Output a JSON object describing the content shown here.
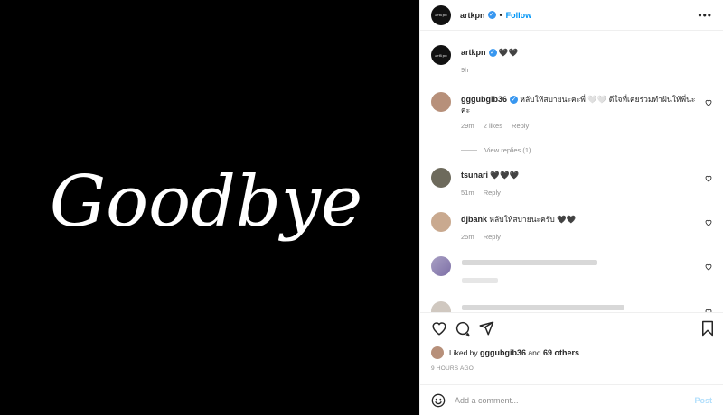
{
  "media": {
    "image_text": "Goodbye",
    "background": "#000000",
    "text_color": "#ffffff"
  },
  "header": {
    "username": "artkpn",
    "separator": "•",
    "follow_label": "Follow",
    "more_icon": "ellipsis-icon"
  },
  "caption": {
    "username": "artkpn",
    "text": "🖤🖤",
    "time": "9h"
  },
  "comments": [
    {
      "username": "gggubgib36",
      "text": "หลับให้สบายนะคะพี่ 🤍🤍 ดีใจที่เคยร่วมทำฝันให้พี่นะคะ",
      "time": "29m",
      "likes": "2 likes",
      "reply": "Reply",
      "view_replies": "View replies (1)"
    },
    {
      "username": "tsunari",
      "text": "🖤🖤🖤",
      "time": "51m",
      "reply": "Reply"
    },
    {
      "username": "djbank",
      "text": "หลับให้สบายนะครับ 🖤🖤",
      "time": "25m",
      "reply": "Reply"
    }
  ],
  "likes": {
    "prefix": "Liked by",
    "user": "gggubgib36",
    "and": "and",
    "others": "69 others"
  },
  "time_ago": "9 HOURS AGO",
  "add_comment": {
    "placeholder": "Add a comment...",
    "post_label": "Post"
  },
  "colors": {
    "accent": "#0095f6",
    "verified": "#3897f0",
    "post_disabled": "#b2dffc",
    "muted": "#8e8e8e"
  }
}
